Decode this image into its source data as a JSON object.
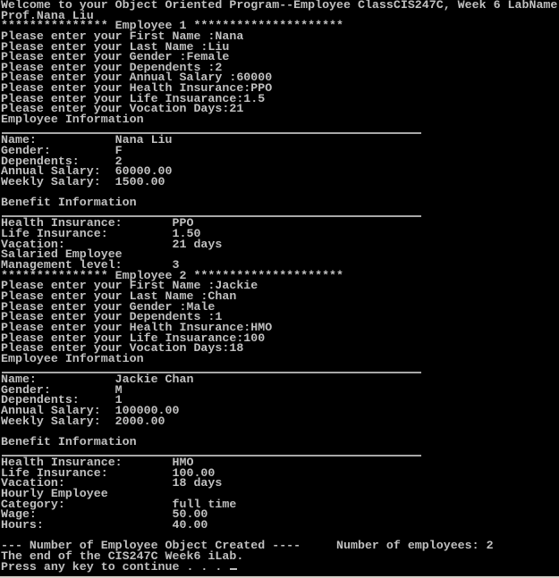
{
  "window": {
    "type": "console",
    "foreground_color": "#c0c0c0",
    "background_color": "#000000"
  },
  "header": {
    "welcome_line": "Welcome to your Object Oriented Program--Employee ClassCIS247C, Week 6 LabName:",
    "author_line": "Prof.Nana Liu"
  },
  "employees": [
    {
      "banner": "*************** Employee 1 *********************",
      "prompts": [
        "Please enter your First Name :Nana",
        "Please enter your Last Name :Liu",
        "Please enter your Gender :Female",
        "Please enter your Dependents :2",
        "Please enter your Annual Salary :60000",
        "Please enter your Health Insurance:PPO",
        "Please enter your Life Insuarance:1.5",
        "Please enter your Vocation Days:21"
      ],
      "info_title": "Employee Information",
      "info": [
        "Name:           Nana Liu",
        "Gender:         F",
        "Dependents:     2",
        "Annual Salary:  60000.00",
        "Weekly Salary:  1500.00"
      ],
      "benefit_title": "Benefit Information",
      "benefits": [
        "Health Insurance:       PPO",
        "Life Insurance:         1.50",
        "Vacation:               21 days"
      ],
      "type_label": "Salaried Employee",
      "type_details": [
        "Management level:       3"
      ]
    },
    {
      "banner": "*************** Employee 2 *********************",
      "prompts": [
        "Please enter your First Name :Jackie",
        "Please enter your Last Name :Chan",
        "Please enter your Gender :Male",
        "Please enter your Dependents :1",
        "Please enter your Health Insurance:HMO",
        "Please enter your Life Insuarance:100",
        "Please enter your Vocation Days:18"
      ],
      "info_title": "Employee Information",
      "info": [
        "Name:           Jackie Chan",
        "Gender:         M",
        "Dependents:     1",
        "Annual Salary:  100000.00",
        "Weekly Salary:  2000.00"
      ],
      "benefit_title": "Benefit Information",
      "benefits": [
        "Health Insurance:       HMO",
        "Life Insurance:         100.00",
        "Vacation:               18 days"
      ],
      "type_label": "Hourly Employee",
      "type_details": [
        "Category:               full time",
        "Wage:                   50.00",
        "Hours:                  40.00"
      ]
    }
  ],
  "footer": {
    "count_line": "--- Number of Employee Object Created ----     Number of employees: 2",
    "end_line": "The end of the CIS247C Week6 iLab.",
    "press_key_line": "Press any key to continue . . . "
  }
}
